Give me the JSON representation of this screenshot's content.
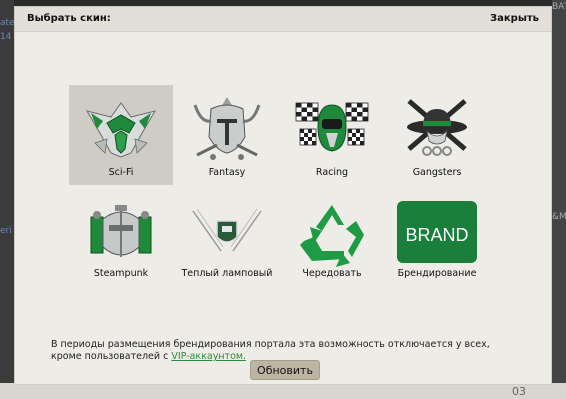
{
  "background": {
    "left_fragments": [
      "ate",
      "14",
      "eri"
    ],
    "right_fragments": [
      "BATT",
      "&M"
    ],
    "bottom_number": "03"
  },
  "modal": {
    "title": "Выбрать скин:",
    "close_label": "Закрыть"
  },
  "skins": [
    {
      "label": "Sci-Fi",
      "icon": "scifi-helmet-icon",
      "selected": true
    },
    {
      "label": "Fantasy",
      "icon": "fantasy-helmet-icon",
      "selected": false
    },
    {
      "label": "Racing",
      "icon": "racing-helmet-flags-icon",
      "selected": false
    },
    {
      "label": "Gangsters",
      "icon": "gangster-hat-guns-icon",
      "selected": false
    },
    {
      "label": "Steampunk",
      "icon": "steampunk-helmet-icon",
      "selected": false
    },
    {
      "label": "Теплый ламповый",
      "icon": "warm-lamp-emblem-icon",
      "selected": false
    },
    {
      "label": "Чередовать",
      "icon": "recycle-icon",
      "selected": false
    },
    {
      "label": "Брендирование",
      "icon": "brand-icon",
      "selected": false,
      "icon_text": "BRAND"
    }
  ],
  "notice": {
    "text_before": "В периоды размещения брендирования портала эта возможность отключается у всех, кроме пользователей с ",
    "link_text": "VIP-аккаунтом."
  },
  "refresh_button": "Обновить",
  "colors": {
    "accent_green": "#1f8a3c",
    "brand_green": "#1a7f3a",
    "modal_bg": "#eeece7",
    "selected_bg": "#cfccc6",
    "button_bg": "#bcb5a4"
  }
}
